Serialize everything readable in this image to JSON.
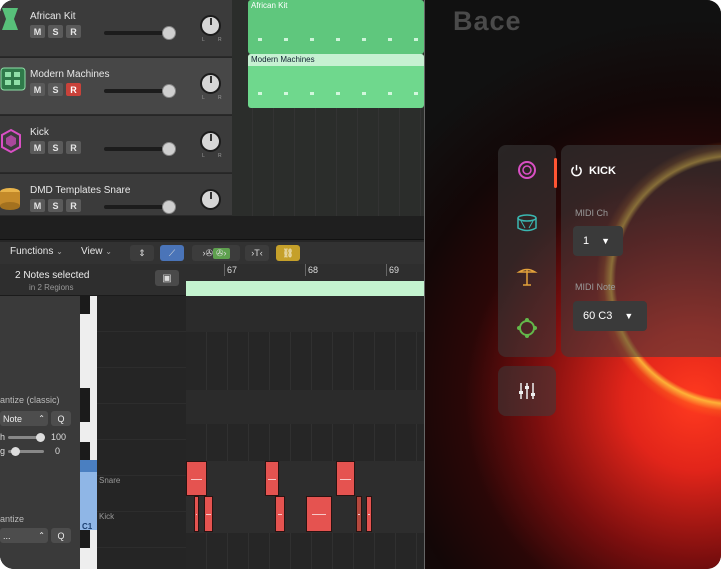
{
  "tracks": [
    {
      "name": "African Kit",
      "m": "M",
      "s": "S",
      "r": "R"
    },
    {
      "name": "Modern Machines",
      "m": "M",
      "s": "S",
      "r": "R"
    },
    {
      "name": "Kick",
      "m": "M",
      "s": "S",
      "r": "R"
    },
    {
      "name": "DMD Templates Snare",
      "m": "M",
      "s": "S",
      "r": "R"
    }
  ],
  "regions": [
    {
      "label": "African Kit"
    },
    {
      "label": "Modern Machines"
    }
  ],
  "toolbar": {
    "functions": "Functions",
    "view": "View"
  },
  "piano_roll": {
    "selection": "2 Notes selected",
    "regions_info": "in 2 Regions",
    "ruler": [
      "67",
      "68",
      "69"
    ],
    "row_labels": {
      "snare": "Snare",
      "kick": "Kick"
    },
    "key_label": "C1"
  },
  "inspector": {
    "quantize_classic": "antize (classic)",
    "note_value": "Note",
    "q_label": "Q",
    "strength_label": "h",
    "strength_value": "100",
    "swing_label": "g",
    "swing_value": "0",
    "quantize2": "antize",
    "quantize2_value": "...",
    "q2_label": "Q"
  },
  "bace": {
    "title": "Bace",
    "instrument": "KICK",
    "midi_ch_label": "MIDI Ch",
    "midi_ch_value": "1",
    "midi_note_label": "MIDI Note",
    "midi_note_value": "60 C3",
    "accent": "#ff5533"
  }
}
